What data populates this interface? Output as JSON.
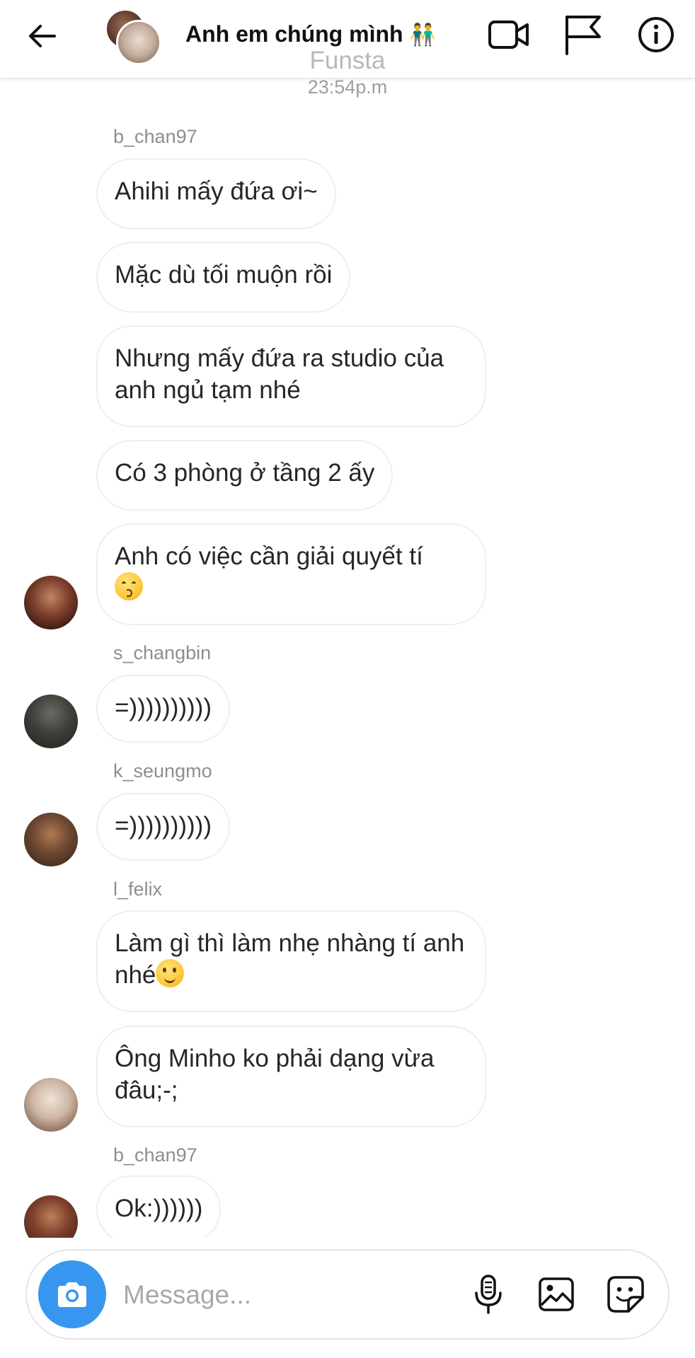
{
  "header": {
    "title": "Anh em chúng mình",
    "title_emoji": "👬",
    "overlay_text": "Funsta",
    "time": "23:54p.m"
  },
  "messages": [
    {
      "sender": "b_chan97",
      "text": "Ahihi mấy đứa ơi~"
    },
    {
      "sender": "b_chan97",
      "text": "Mặc dù tối muộn rồi"
    },
    {
      "sender": "b_chan97",
      "text": "Nhưng mấy đứa ra studio của anh ngủ tạm nhé"
    },
    {
      "sender": "b_chan97",
      "text": "Có 3 phòng ở tầng 2 ấy"
    },
    {
      "sender": "b_chan97",
      "text": "Anh có việc cần giải quyết tí",
      "emoji": "kissing-face"
    },
    {
      "sender": "s_changbin",
      "text": "=))))))))))"
    },
    {
      "sender": "k_seungmo",
      "text": "=))))))))))"
    },
    {
      "sender": "l_felix",
      "text": "Làm gì thì làm nhẹ nhàng tí anh nhé",
      "emoji": "slightly-smiling-face"
    },
    {
      "sender": "l_felix",
      "text": "Ông Minho ko phải dạng vừa đâu;-;"
    },
    {
      "sender": "b_chan97",
      "text": "Ok:))))))"
    }
  ],
  "composer": {
    "placeholder": "Message..."
  },
  "icons": {
    "back": "back-arrow-icon",
    "video": "video-camera-icon",
    "flag": "flag-icon",
    "info": "info-icon",
    "camera": "camera-icon",
    "mic": "microphone-icon",
    "gallery": "gallery-icon",
    "sticker": "sticker-icon"
  },
  "colors": {
    "accent": "#3797f0",
    "bubble_border": "#efefef",
    "secondary_text": "#8e8e8e"
  }
}
